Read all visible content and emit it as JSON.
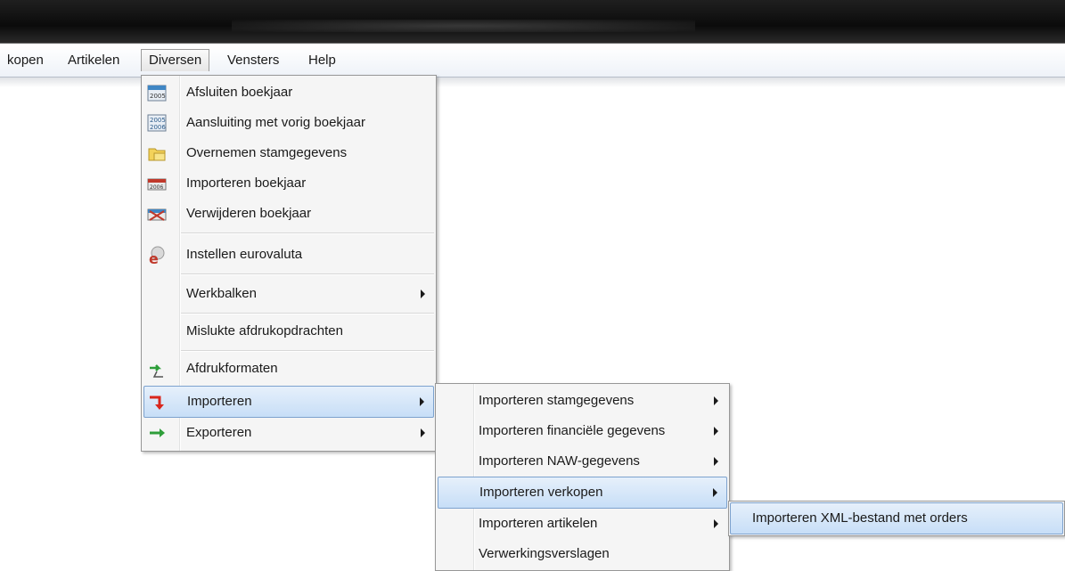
{
  "menubar": {
    "items": [
      {
        "label": "kopen"
      },
      {
        "label": "Artikelen"
      },
      {
        "label": "Diversen"
      },
      {
        "label": "Vensters"
      },
      {
        "label": "Help"
      }
    ]
  },
  "diversen_menu": {
    "items": [
      {
        "label": "Afsluiten boekjaar",
        "icon": "calendar-2005-icon"
      },
      {
        "label": "Aansluiting met vorig boekjaar",
        "icon": "calendar-2005-2006-icon"
      },
      {
        "label": "Overnemen stamgegevens",
        "icon": "folder-icon"
      },
      {
        "label": "Importeren boekjaar",
        "icon": "import-year-icon"
      },
      {
        "label": "Verwijderen boekjaar",
        "icon": "delete-year-icon"
      },
      {
        "label": "Instellen eurovaluta",
        "icon": "euro-icon"
      },
      {
        "label": "Werkbalken",
        "submenu": true
      },
      {
        "label": "Mislukte afdrukopdrachten"
      },
      {
        "label": "Afdrukformaten",
        "icon": "print-format-icon"
      },
      {
        "label": "Importeren",
        "icon": "import-arrow-icon",
        "submenu": true
      },
      {
        "label": "Exporteren",
        "icon": "export-arrow-icon",
        "submenu": true
      }
    ]
  },
  "importeren_menu": {
    "items": [
      {
        "label": "Importeren stamgegevens",
        "submenu": true
      },
      {
        "label": "Importeren financiële gegevens",
        "submenu": true
      },
      {
        "label": "Importeren NAW-gegevens",
        "submenu": true
      },
      {
        "label": "Importeren verkopen",
        "submenu": true
      },
      {
        "label": "Importeren artikelen",
        "submenu": true
      },
      {
        "label": "Verwerkingsverslagen"
      }
    ]
  },
  "verkopen_menu": {
    "items": [
      {
        "label": "Importeren XML-bestand met orders"
      }
    ]
  },
  "colors": {
    "highlight_border": "#7da2ce",
    "highlight_fill": "#c7def7",
    "menu_bg": "#f5f5f5"
  }
}
